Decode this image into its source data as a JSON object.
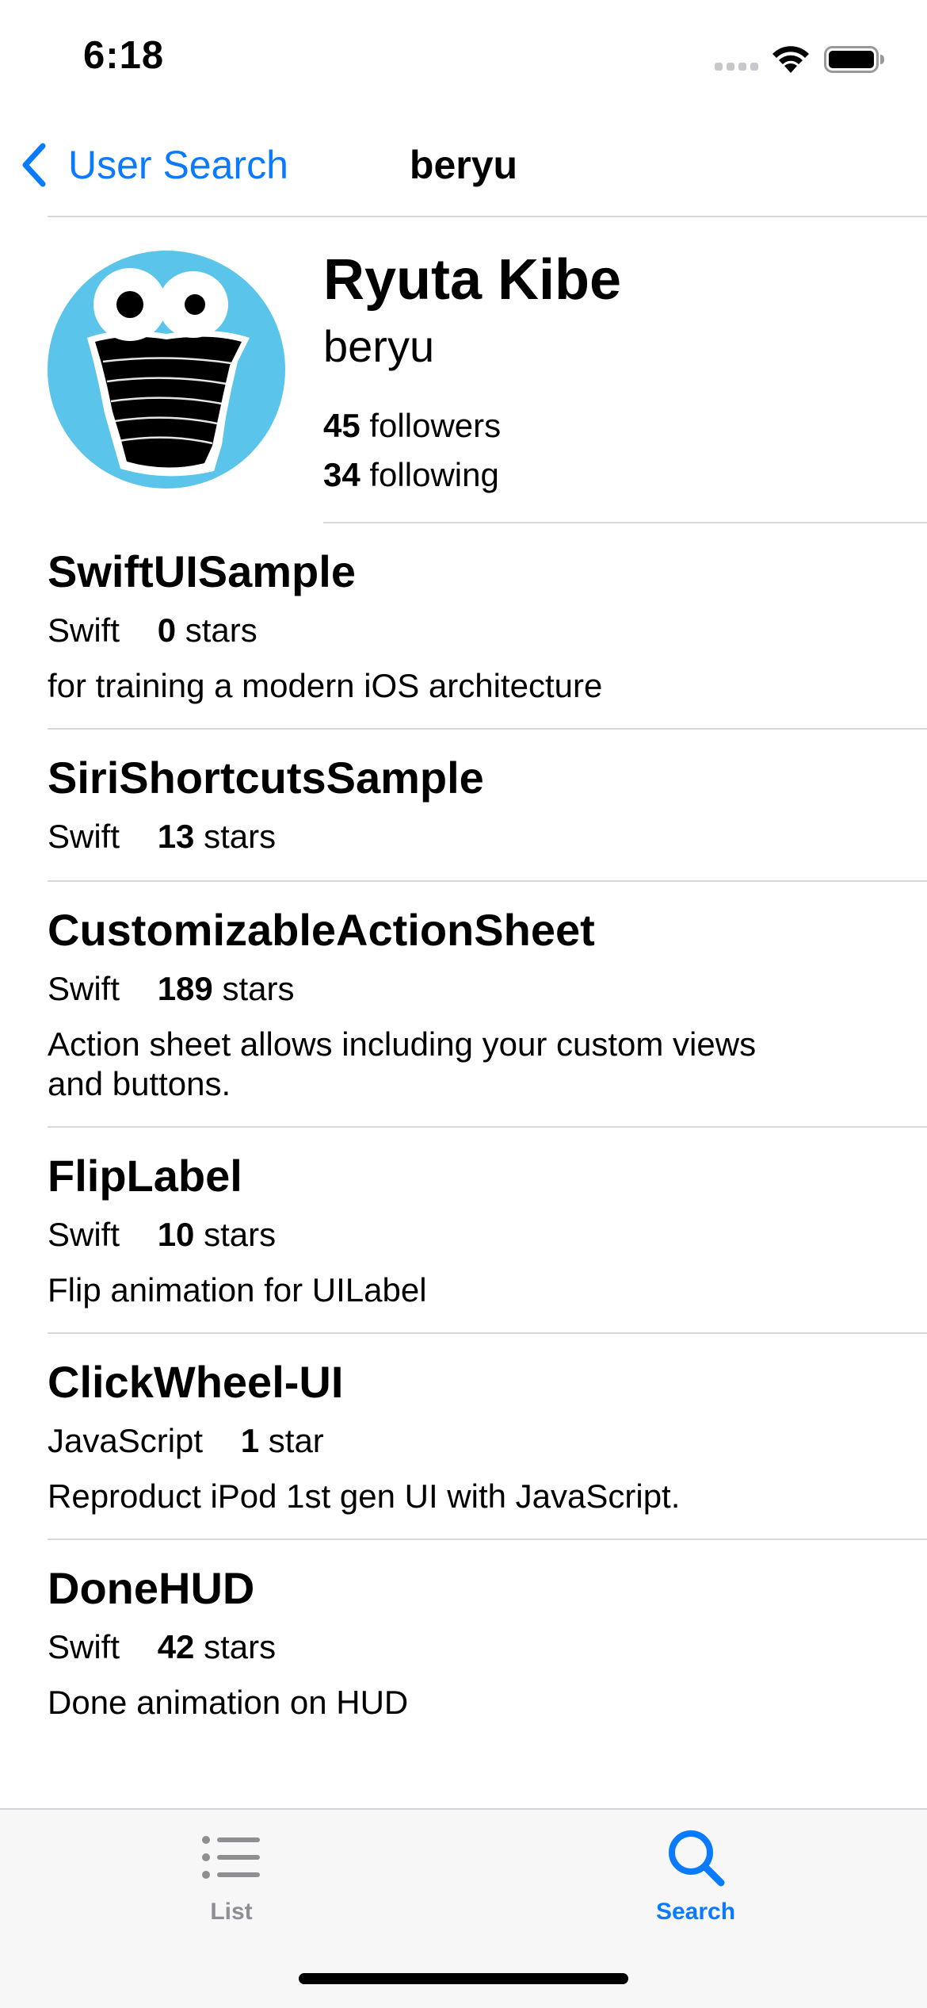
{
  "status_bar": {
    "time": "6:18"
  },
  "nav": {
    "back_label": "User Search",
    "title": "beryu"
  },
  "profile": {
    "name": "Ryuta Kibe",
    "login": "beryu",
    "followers_count": "45",
    "followers_label": "followers",
    "following_count": "34",
    "following_label": "following",
    "avatar_background": "#5bc4ea"
  },
  "repos": [
    {
      "name": "SwiftUISample",
      "language": "Swift",
      "stars": "0",
      "stars_label": "stars",
      "description": "for training a modern iOS architecture"
    },
    {
      "name": "SiriShortcutsSample",
      "language": "Swift",
      "stars": "13",
      "stars_label": "stars",
      "description": ""
    },
    {
      "name": "CustomizableActionSheet",
      "language": "Swift",
      "stars": "189",
      "stars_label": "stars",
      "description": "Action sheet allows including your custom views and buttons."
    },
    {
      "name": "FlipLabel",
      "language": "Swift",
      "stars": "10",
      "stars_label": "stars",
      "description": "Flip animation for UILabel"
    },
    {
      "name": "ClickWheel-UI",
      "language": "JavaScript",
      "stars": "1",
      "stars_label": "star",
      "description": "Reproduct iPod 1st gen UI with JavaScript."
    },
    {
      "name": "DoneHUD",
      "language": "Swift",
      "stars": "42",
      "stars_label": "stars",
      "description": "Done animation on HUD"
    }
  ],
  "tab_bar": {
    "tabs": [
      {
        "label": "List",
        "icon": "list-icon",
        "selected": false
      },
      {
        "label": "Search",
        "icon": "search-icon",
        "selected": true
      }
    ]
  },
  "colors": {
    "accent": "#0a7aff",
    "inactive_tab": "#8e8e93",
    "separator": "#d8d8dc",
    "tab_bar_background": "#f7f7f7"
  }
}
